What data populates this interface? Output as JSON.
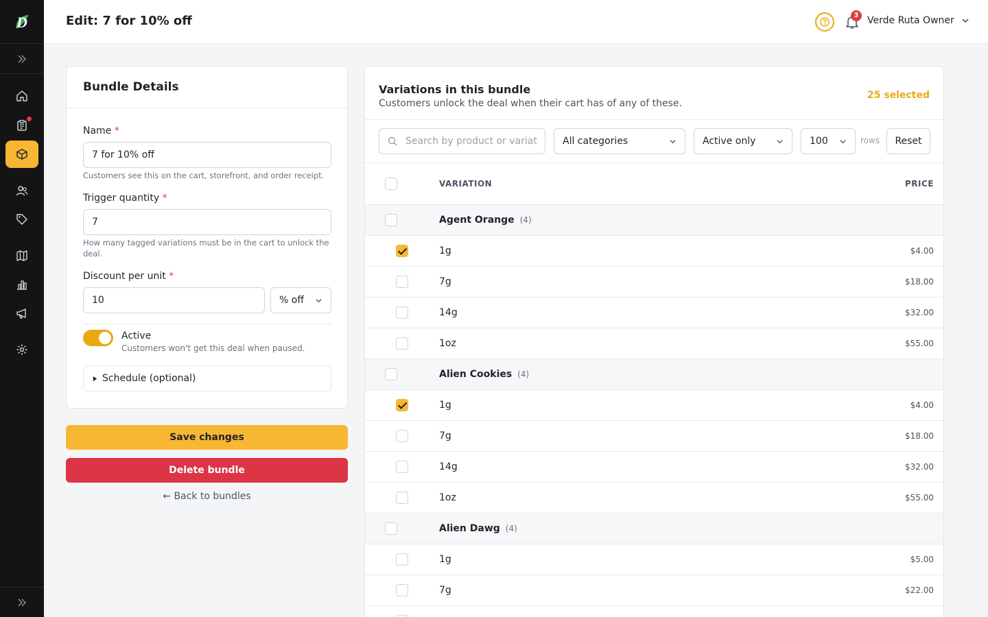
{
  "app": {
    "logo_letter": "D"
  },
  "header": {
    "title": "Edit: 7 for 10% off",
    "notifications_count": "3",
    "user_name": "Verde Ruta Owner"
  },
  "sidebar": {
    "items": [
      {
        "icon": "home-icon",
        "active": false
      },
      {
        "icon": "orders-icon",
        "active": false,
        "has_dot": true
      },
      {
        "icon": "box-icon",
        "active": true
      },
      {
        "icon": "users-icon",
        "active": false
      },
      {
        "icon": "tag-icon",
        "active": false
      },
      {
        "icon": "map-icon",
        "active": false
      },
      {
        "icon": "bar-chart-icon",
        "active": false
      },
      {
        "icon": "megaphone-icon",
        "active": false
      },
      {
        "icon": "gear-icon",
        "active": false
      }
    ]
  },
  "details": {
    "heading": "Bundle Details",
    "name_label": "Name",
    "name_value": "7 for 10% off",
    "name_hint": "Customers see this on the cart, storefront, and order receipt.",
    "trigger_label": "Trigger quantity",
    "trigger_value": "7",
    "trigger_hint": "How many tagged variations must be in the cart to unlock the deal.",
    "discount_label": "Discount per unit",
    "discount_value": "10",
    "discount_type": "% off",
    "required_mark": "*",
    "active_label": "Active",
    "active_hint": "Customers won't get this deal when paused.",
    "active_on": true,
    "schedule_label": "Schedule (optional)"
  },
  "actions": {
    "save": "Save changes",
    "delete": "Delete bundle",
    "back": "← Back to bundles"
  },
  "variations": {
    "title": "Variations in this bundle",
    "subtitle": "Customers unlock the deal when their cart has of any of these.",
    "selected_count": "25 selected",
    "search_placeholder": "Search by product or variat",
    "category_filter": "All categories",
    "status_filter": "Active only",
    "rows_value": "100",
    "rows_label": "rows",
    "reset": "Reset",
    "col_variation": "VARIATION",
    "col_price": "PRICE",
    "groups": [
      {
        "name": "Agent Orange",
        "count": "(4)",
        "items": [
          {
            "name": "1g",
            "price": "$4.00",
            "checked": true
          },
          {
            "name": "7g",
            "price": "$18.00",
            "checked": false
          },
          {
            "name": "14g",
            "price": "$32.00",
            "checked": false
          },
          {
            "name": "1oz",
            "price": "$55.00",
            "checked": false
          }
        ]
      },
      {
        "name": "Alien Cookies",
        "count": "(4)",
        "items": [
          {
            "name": "1g",
            "price": "$4.00",
            "checked": true
          },
          {
            "name": "7g",
            "price": "$18.00",
            "checked": false
          },
          {
            "name": "14g",
            "price": "$32.00",
            "checked": false
          },
          {
            "name": "1oz",
            "price": "$55.00",
            "checked": false
          }
        ]
      },
      {
        "name": "Alien Dawg",
        "count": "(4)",
        "items": [
          {
            "name": "1g",
            "price": "$5.00",
            "checked": false
          },
          {
            "name": "7g",
            "price": "$22.00",
            "checked": false
          },
          {
            "name": "",
            "price": "",
            "checked": false
          }
        ]
      }
    ]
  },
  "colors": {
    "accent": "#f8b733",
    "danger": "#dc3545",
    "sidebar_bg": "#141414"
  }
}
